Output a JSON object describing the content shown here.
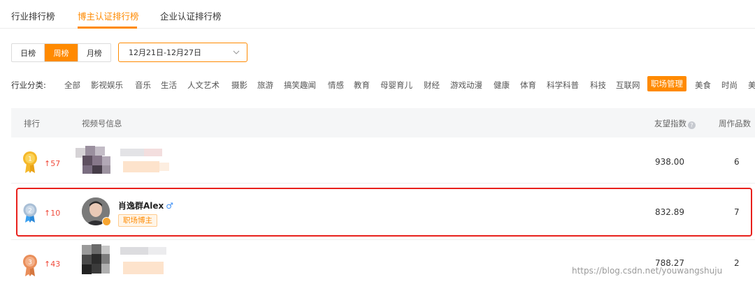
{
  "tabs": [
    {
      "label": "行业排行榜"
    },
    {
      "label": "博主认证排行榜"
    },
    {
      "label": "企业认证排行榜"
    }
  ],
  "period": [
    "日榜",
    "周榜",
    "月榜"
  ],
  "date_range": "12月21日-12月27日",
  "category_label": "行业分类:",
  "categories": [
    "全部",
    "影视娱乐",
    "音乐",
    "生活",
    "人文艺术",
    "摄影",
    "旅游",
    "搞笑趣闻",
    "情感",
    "教育",
    "母婴育儿",
    "财经",
    "游戏动漫",
    "健康",
    "体育",
    "科学科普",
    "科技",
    "互联网",
    "职场管理",
    "美食",
    "时尚",
    "美"
  ],
  "table": {
    "headers": {
      "rank": "排行",
      "info": "视频号信息",
      "index": "友望指数",
      "works": "周作品数"
    },
    "rows": [
      {
        "rank": 1,
        "trend": "57",
        "index": "938.00",
        "works": "6"
      },
      {
        "rank": 2,
        "trend": "10",
        "name": "肖逸群Alex",
        "gender": "♂",
        "tag": "职场博主",
        "index": "832.89",
        "works": "7"
      },
      {
        "rank": 3,
        "trend": "43",
        "index": "788.27",
        "works": "2"
      }
    ]
  },
  "watermark": "https://blog.csdn.net/youwangshuju",
  "colors": {
    "accent": "#ff8a00",
    "gold": "#f5b82a",
    "silver": "#a9bfd6",
    "bronze": "#e98e5a",
    "trend_up": "#f04b3c",
    "highlight": "#e8201c"
  }
}
